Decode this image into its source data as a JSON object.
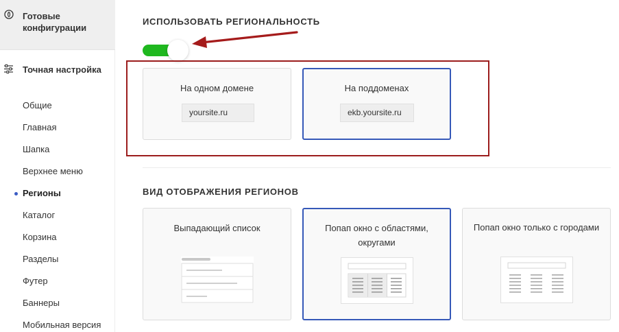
{
  "sidebar": {
    "ready_configs": {
      "label": "Готовые конфигурации",
      "icon": "config-circle-icon"
    },
    "fine_tune": {
      "label": "Точная настройка",
      "icon": "sliders-icon"
    },
    "items": [
      {
        "label": "Общие",
        "active": false
      },
      {
        "label": "Главная",
        "active": false
      },
      {
        "label": "Шапка",
        "active": false
      },
      {
        "label": "Верхнее меню",
        "active": false
      },
      {
        "label": "Регионы",
        "active": true
      },
      {
        "label": "Каталог",
        "active": false
      },
      {
        "label": "Корзина",
        "active": false
      },
      {
        "label": "Разделы",
        "active": false
      },
      {
        "label": "Футер",
        "active": false
      },
      {
        "label": "Баннеры",
        "active": false
      },
      {
        "label": "Мобильная версия",
        "active": false
      }
    ],
    "active_dot_color": "#3b5cc4"
  },
  "regionality": {
    "title": "ИСПОЛЬЗОВАТЬ РЕГИОНАЛЬНОСТЬ",
    "toggle_on": true,
    "toggle_color": "#1fb81f",
    "options": [
      {
        "label": "На одном домене",
        "example": "yoursite.ru",
        "selected": false
      },
      {
        "label": "На поддоменах",
        "example": "ekb.yoursite.ru",
        "selected": true
      }
    ],
    "annotation_color": "#9b1c1c"
  },
  "display": {
    "title": "ВИД ОТОБРАЖЕНИЯ РЕГИОНОВ",
    "options": [
      {
        "label": "Выпадающий список",
        "selected": false
      },
      {
        "label": "Попап окно с областями, округами",
        "selected": true
      },
      {
        "label": "Попап окно только с городами",
        "selected": false
      }
    ]
  },
  "accent_color": "#3558b8"
}
